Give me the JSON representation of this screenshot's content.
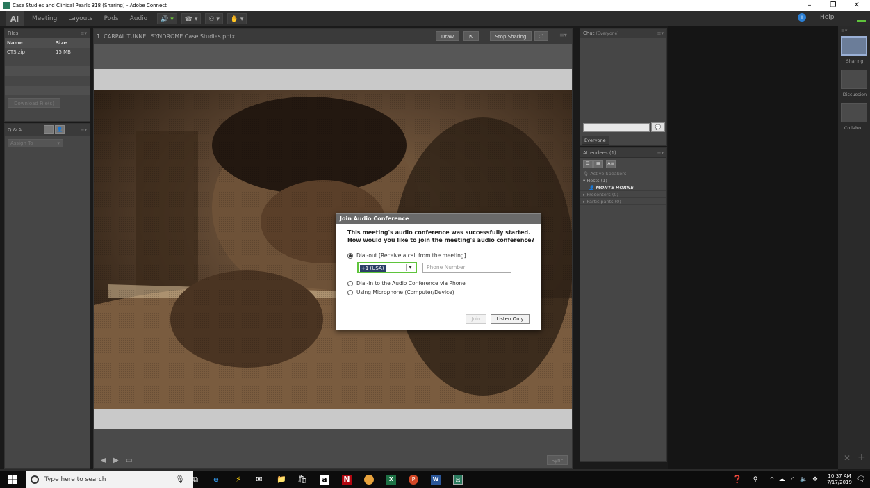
{
  "window": {
    "title": "Case Studies and Clinical Pearls 318 (Sharing) - Adobe Connect",
    "minimize": "–",
    "maximize": "❐",
    "close": "✕"
  },
  "menu": {
    "logo": "Ai",
    "items": [
      "Meeting",
      "Layouts",
      "Pods",
      "Audio"
    ],
    "right_help": "Help"
  },
  "files_pod": {
    "title": "Files",
    "columns": [
      "Name",
      "Size"
    ],
    "rows": [
      {
        "name": "CTS.zip",
        "size": "15 MB"
      }
    ],
    "download_button": "Download File(s)"
  },
  "qa_pod": {
    "title": "Q & A",
    "assign_to": "Assign To"
  },
  "share_pod": {
    "title": "1. CARPAL TUNNEL SYNDROME Case Studies.pptx",
    "draw_button": "Draw",
    "stop_sharing_button": "Stop Sharing",
    "sync_button": "Sync"
  },
  "dialog": {
    "title": "Join Audio Conference",
    "message_line1": "This meeting's audio conference was successfully started.",
    "message_line2": "How would you like to join the meeting's audio conference?",
    "option_dialout": "Dial-out [Receive a call from the meeting]",
    "country_code": "+1 (USA)",
    "phone_placeholder": "Phone Number",
    "option_dialin": "Dial-in to the Audio Conference via Phone",
    "option_microphone": "Using Microphone (Computer/Device)",
    "join_button": "Join",
    "listen_only_button": "Listen Only"
  },
  "chat_pod": {
    "title": "Chat",
    "title_scope": "(Everyone)",
    "tab": "Everyone"
  },
  "attendees_pod": {
    "title": "Attendees",
    "count": "(1)",
    "active_speakers": "Active Speakers",
    "hosts": "Hosts (1)",
    "host_name": "MONTE HORNE",
    "presenters": "Presenters (0)",
    "participants": "Participants (0)"
  },
  "right_nav": {
    "items": [
      "Sharing",
      "Discussion",
      "Collabo..."
    ]
  },
  "taskbar": {
    "search_placeholder": "Type here to search",
    "time": "10:37 AM",
    "date": "7/17/2019"
  }
}
